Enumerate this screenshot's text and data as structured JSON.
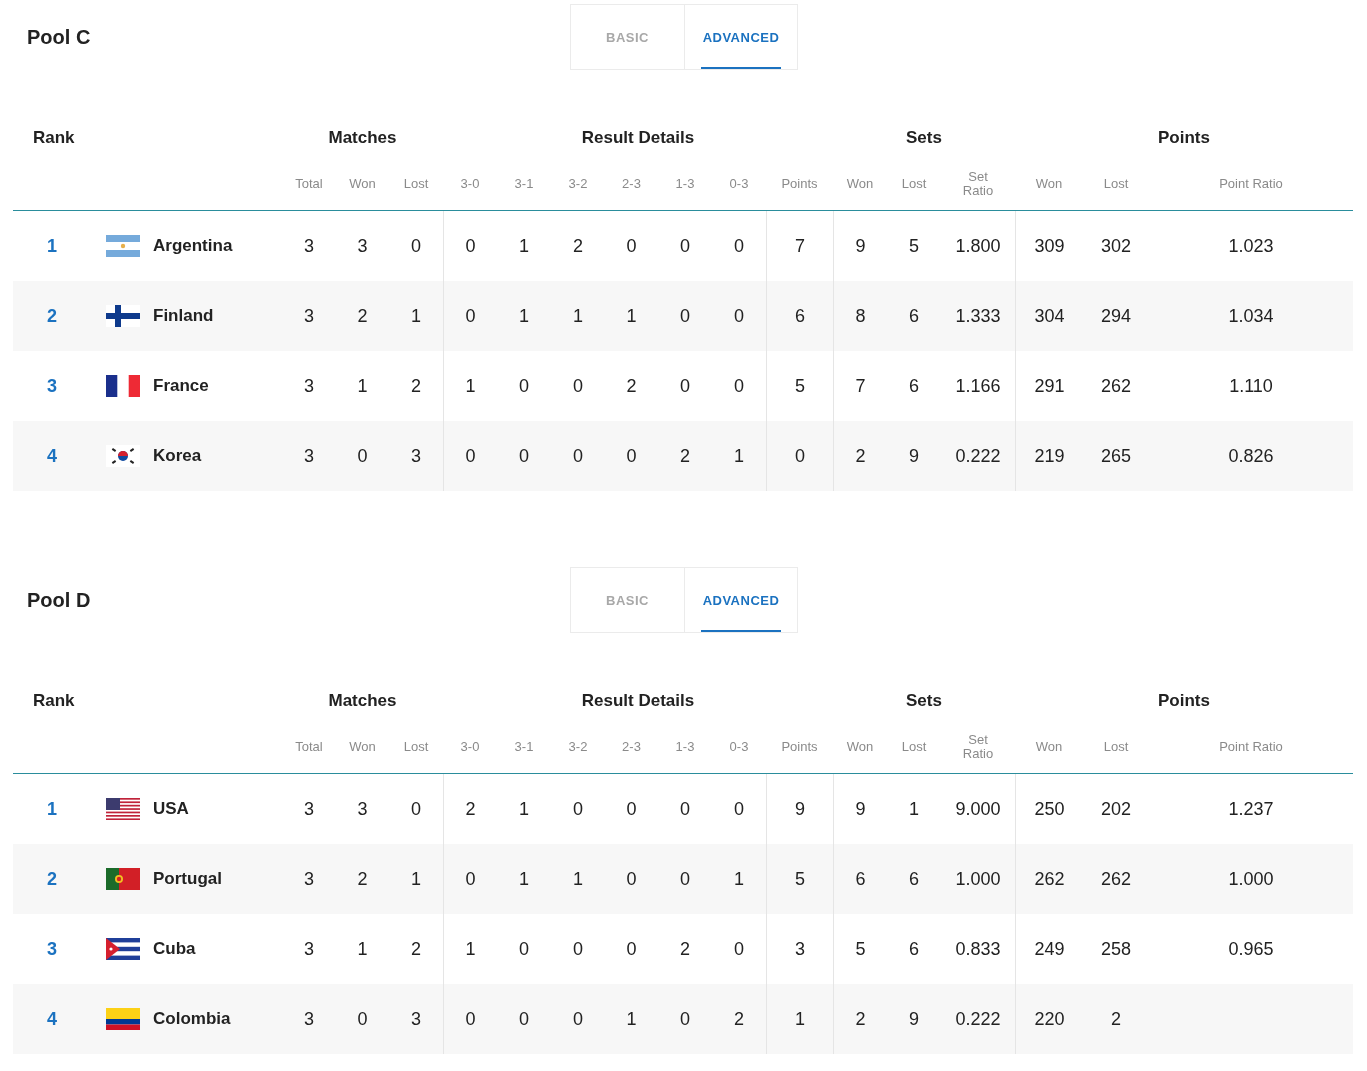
{
  "pools": [
    {
      "title": "Pool C",
      "tabs": [
        {
          "label": "BASIC",
          "selected": false
        },
        {
          "label": "ADVANCED",
          "selected": true
        }
      ],
      "group_headers": [
        "Rank",
        "Matches",
        "Result Details",
        "Sets",
        "Points"
      ],
      "columns": [
        "Total",
        "Won",
        "Lost",
        "3-0",
        "3-1",
        "3-2",
        "2-3",
        "1-3",
        "0-3",
        "Points",
        "Won",
        "Lost",
        "Set Ratio",
        "Won",
        "Lost",
        "Point Ratio"
      ],
      "rows": [
        {
          "rank": "1",
          "kind": "ar",
          "team": "Argentina",
          "values": [
            "3",
            "3",
            "0",
            "0",
            "1",
            "2",
            "0",
            "0",
            "0",
            "7",
            "9",
            "5",
            "1.800",
            "309",
            "302",
            "1.023"
          ]
        },
        {
          "rank": "2",
          "kind": "fi",
          "team": "Finland",
          "values": [
            "3",
            "2",
            "1",
            "0",
            "1",
            "1",
            "1",
            "0",
            "0",
            "6",
            "8",
            "6",
            "1.333",
            "304",
            "294",
            "1.034"
          ]
        },
        {
          "rank": "3",
          "kind": "fr",
          "team": "France",
          "values": [
            "3",
            "1",
            "2",
            "1",
            "0",
            "0",
            "2",
            "0",
            "0",
            "5",
            "7",
            "6",
            "1.166",
            "291",
            "262",
            "1.110"
          ]
        },
        {
          "rank": "4",
          "kind": "kr",
          "team": "Korea",
          "values": [
            "3",
            "0",
            "3",
            "0",
            "0",
            "0",
            "0",
            "2",
            "1",
            "0",
            "2",
            "9",
            "0.222",
            "219",
            "265",
            "0.826"
          ]
        }
      ]
    },
    {
      "title": "Pool D",
      "tabs": [
        {
          "label": "BASIC",
          "selected": false
        },
        {
          "label": "ADVANCED",
          "selected": true
        }
      ],
      "group_headers": [
        "Rank",
        "Matches",
        "Result Details",
        "Sets",
        "Points"
      ],
      "columns": [
        "Total",
        "Won",
        "Lost",
        "3-0",
        "3-1",
        "3-2",
        "2-3",
        "1-3",
        "0-3",
        "Points",
        "Won",
        "Lost",
        "Set Ratio",
        "Won",
        "Lost",
        "Point Ratio"
      ],
      "rows": [
        {
          "rank": "1",
          "kind": "us",
          "team": "USA",
          "values": [
            "3",
            "3",
            "0",
            "2",
            "1",
            "0",
            "0",
            "0",
            "0",
            "9",
            "9",
            "1",
            "9.000",
            "250",
            "202",
            "1.237"
          ]
        },
        {
          "rank": "2",
          "kind": "pt",
          "team": "Portugal",
          "values": [
            "3",
            "2",
            "1",
            "0",
            "1",
            "1",
            "0",
            "0",
            "1",
            "5",
            "6",
            "6",
            "1.000",
            "262",
            "262",
            "1.000"
          ]
        },
        {
          "rank": "3",
          "kind": "cu",
          "team": "Cuba",
          "values": [
            "3",
            "1",
            "2",
            "1",
            "0",
            "0",
            "0",
            "2",
            "0",
            "3",
            "5",
            "6",
            "0.833",
            "249",
            "258",
            "0.965"
          ]
        },
        {
          "rank": "4",
          "kind": "co",
          "team": "Colombia",
          "values": [
            "3",
            "0",
            "3",
            "0",
            "0",
            "0",
            "1",
            "0",
            "2",
            "1",
            "2",
            "9",
            "0.222",
            "220",
            "2"
          ]
        }
      ]
    }
  ]
}
